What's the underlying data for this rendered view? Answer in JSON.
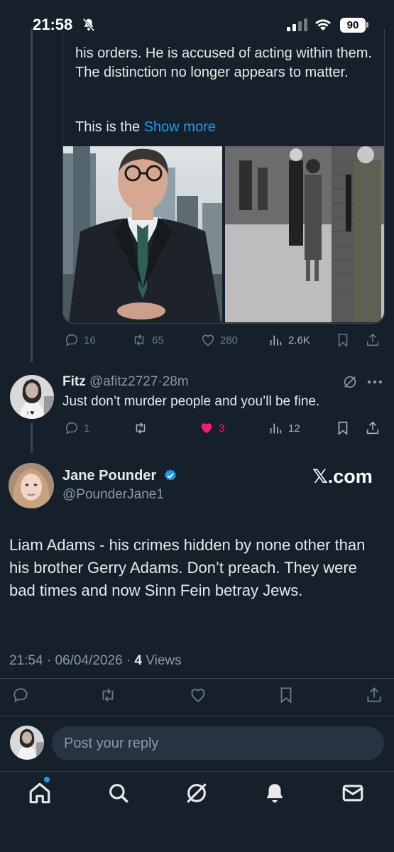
{
  "status_bar": {
    "time": "21:58",
    "battery": "90"
  },
  "quoted_tweet": {
    "text": "his orders. He is accused of acting within them. The distinction no longer appears to matter.",
    "teaser": "This is the",
    "show_more": "Show more",
    "actions": {
      "replies": "16",
      "reposts": "65",
      "likes": "280",
      "views": "2.6K"
    }
  },
  "reply": {
    "name": "Fitz",
    "handle": "@afitz2727",
    "sep": "·",
    "time": "28m",
    "text": "Just don’t murder people and you’ll be fine.",
    "actions": {
      "replies": "1",
      "likes": "3",
      "views": "12"
    },
    "liked_color": "#f91880"
  },
  "main_tweet": {
    "name": "Jane Pounder",
    "handle": "@PounderJane1",
    "watermark": "𝕏.com",
    "text": "Liam Adams - his crimes hidden by none other than his brother Gerry Adams. Don’t preach. They were bad times and now Sinn Fein betray Jews.",
    "time": "21:54",
    "date": "06/04/2026",
    "sep": "·",
    "views_count": "4",
    "views_label": "Views"
  },
  "composer": {
    "placeholder": "Post your reply"
  },
  "colors": {
    "background": "#15202b",
    "accent": "#1d9bf0",
    "muted": "#8b98a5"
  },
  "nav": {
    "items": [
      "home-icon",
      "search-icon",
      "grok-icon",
      "notifications-icon",
      "messages-icon"
    ]
  }
}
